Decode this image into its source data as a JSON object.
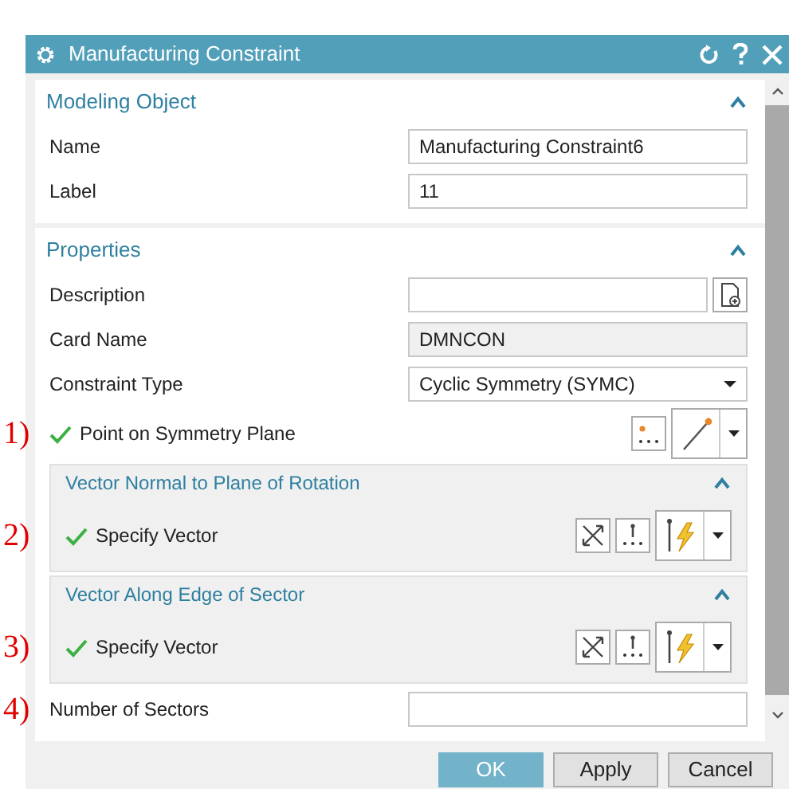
{
  "window": {
    "title": "Manufacturing Constraint"
  },
  "sections": [
    {
      "title": "Modeling Object",
      "expanded": true,
      "rows": [
        {
          "kind": "text",
          "label": "Name",
          "value": "Manufacturing Constraint6"
        },
        {
          "kind": "text",
          "label": "Label",
          "value": "11"
        }
      ]
    },
    {
      "title": "Properties",
      "expanded": true,
      "rows": [
        {
          "kind": "text_with_button",
          "label": "Description"
        },
        {
          "kind": "readonly",
          "label": "Card Name",
          "value": "DMNCON"
        },
        {
          "kind": "dropdown",
          "label": "Constraint Type",
          "value": "Cyclic Symmetry (SYMC)"
        },
        {
          "kind": "point",
          "annotation": "1)",
          "label": "Point on Symmetry Plane",
          "done": true
        },
        {
          "kind": "group",
          "annotation": "2)",
          "title": "Vector Normal to Plane of Rotation",
          "expanded": true,
          "selector": {
            "label": "Specify Vector",
            "done": true
          }
        },
        {
          "kind": "group",
          "annotation": "3)",
          "title": "Vector Along Edge of Sector",
          "expanded": true,
          "selector": {
            "label": "Specify Vector",
            "done": true
          }
        },
        {
          "kind": "text",
          "annotation": "4)",
          "label": "Number of Sectors"
        }
      ]
    }
  ],
  "buttons": [
    {
      "label": "OK",
      "primary": true
    },
    {
      "label": "Apply",
      "primary": false
    },
    {
      "label": "Cancel",
      "primary": false
    }
  ]
}
